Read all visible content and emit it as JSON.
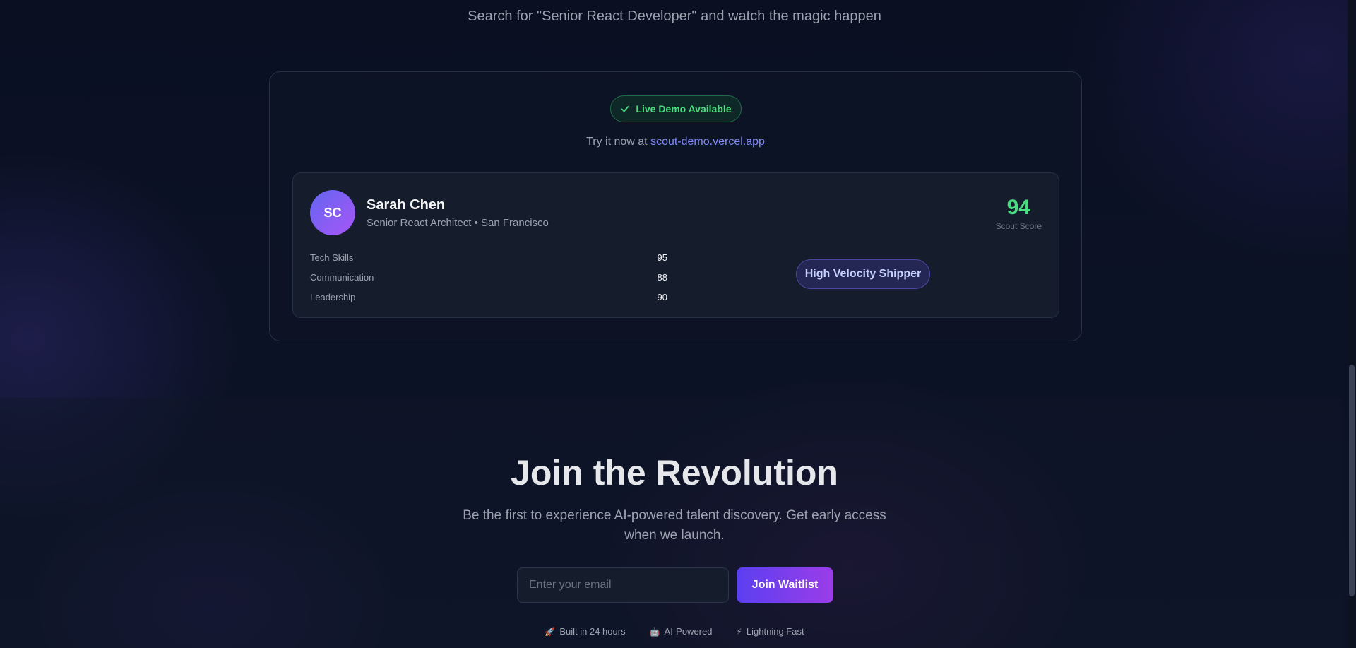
{
  "hero": {
    "subhead": "Search for \"Senior React Developer\" and watch the magic happen"
  },
  "demo": {
    "badge": "Live Demo Available",
    "try_prefix": "Try it now at ",
    "try_link": "scout-demo.vercel.app",
    "profile": {
      "initials": "SC",
      "name": "Sarah Chen",
      "role": "Senior React Architect • San Francisco",
      "score": "94",
      "score_label": "Scout Score",
      "stats": [
        {
          "label": "Tech Skills",
          "value": "95"
        },
        {
          "label": "Communication",
          "value": "88"
        },
        {
          "label": "Leadership",
          "value": "90"
        }
      ],
      "tag": "High Velocity Shipper"
    }
  },
  "join": {
    "title": "Join the Revolution",
    "description": "Be the first to experience AI-powered talent discovery. Get early access when we launch.",
    "email_placeholder": "Enter your email",
    "button": "Join Waitlist",
    "features": [
      {
        "icon": "rocket-icon",
        "glyph": "🚀",
        "label": "Built in 24 hours"
      },
      {
        "icon": "robot-icon",
        "glyph": "🤖",
        "label": "AI-Powered"
      },
      {
        "icon": "lightning-icon",
        "glyph": "⚡",
        "label": "Lightning Fast"
      }
    ]
  },
  "colors": {
    "accent_green": "#4ade80",
    "accent_purple": "#6366f1",
    "link": "#818cf8",
    "background": "#0b1020"
  }
}
